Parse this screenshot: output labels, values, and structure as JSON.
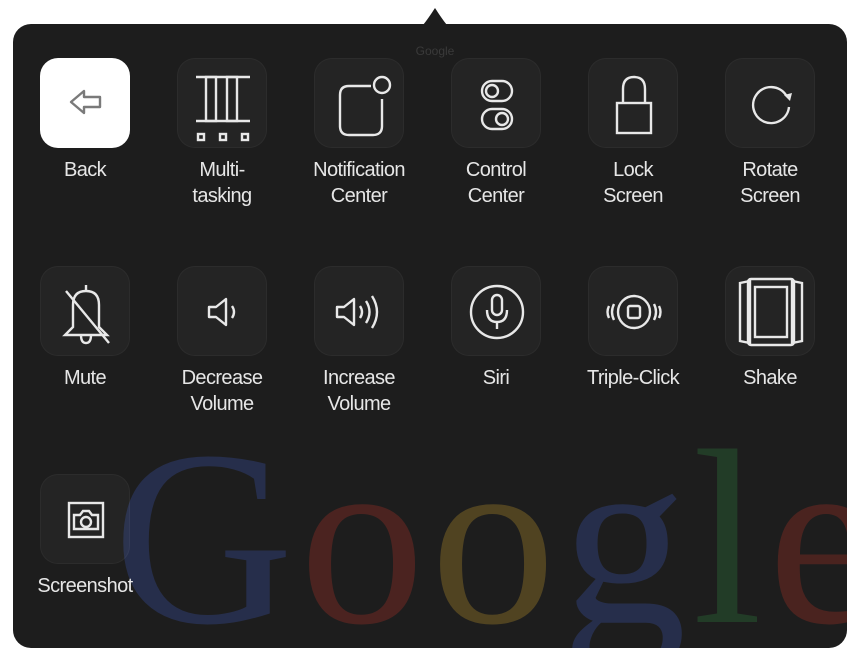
{
  "pointer_label": "Google",
  "watermark": {
    "letters": [
      "G",
      "o",
      "o",
      "g",
      "l",
      "e"
    ],
    "colors": [
      "#3a52a8",
      "#a83227",
      "#b8912a",
      "#3a52a8",
      "#2f7d3c",
      "#a83227"
    ]
  },
  "colors": {
    "panel": "#1d1d1d",
    "icon_stroke": "#e8e8e8",
    "label": "#e6e6e6",
    "selected_tile": "#ffffff"
  },
  "items": [
    {
      "label": "Back",
      "icon": "back-arrow-icon",
      "selected": true
    },
    {
      "label": "Multi-\ntasking",
      "icon": "multitasking-icon",
      "selected": false
    },
    {
      "label": "Notification\nCenter",
      "icon": "notification-center-icon",
      "selected": false
    },
    {
      "label": "Control\nCenter",
      "icon": "control-center-icon",
      "selected": false
    },
    {
      "label": "Lock\nScreen",
      "icon": "lock-icon",
      "selected": false
    },
    {
      "label": "Rotate\nScreen",
      "icon": "rotate-icon",
      "selected": false
    },
    {
      "label": "Mute",
      "icon": "mute-bell-icon",
      "selected": false
    },
    {
      "label": "Decrease\nVolume",
      "icon": "volume-down-icon",
      "selected": false
    },
    {
      "label": "Increase\nVolume",
      "icon": "volume-up-icon",
      "selected": false
    },
    {
      "label": "Siri",
      "icon": "microphone-icon",
      "selected": false
    },
    {
      "label": "Triple-Click",
      "icon": "home-button-icon",
      "selected": false
    },
    {
      "label": "Shake",
      "icon": "shake-icon",
      "selected": false
    },
    {
      "label": "Screenshot",
      "icon": "camera-icon",
      "selected": false
    }
  ]
}
